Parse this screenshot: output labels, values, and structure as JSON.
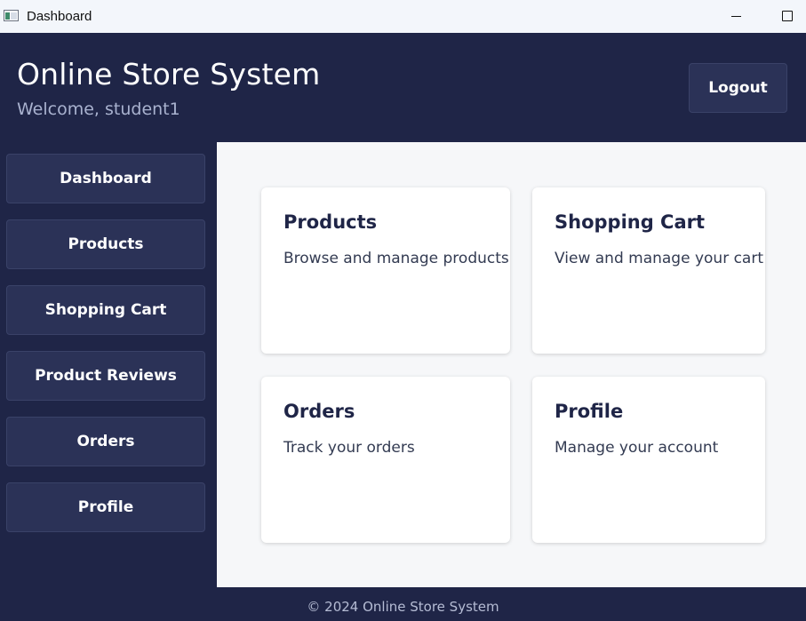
{
  "window": {
    "title": "Dashboard",
    "app_icon": "window-app-icon",
    "controls": [
      "minimize-icon",
      "maximize-icon"
    ]
  },
  "header": {
    "title": "Online Store System",
    "welcome": "Welcome, student1",
    "logout_label": "Logout"
  },
  "sidebar": {
    "items": [
      {
        "label": "Dashboard"
      },
      {
        "label": "Products"
      },
      {
        "label": "Shopping Cart"
      },
      {
        "label": "Product Reviews"
      },
      {
        "label": "Orders"
      },
      {
        "label": "Profile"
      }
    ]
  },
  "main": {
    "cards": [
      {
        "title": "Products",
        "description": "Browse and manage products"
      },
      {
        "title": "Shopping Cart",
        "description": "View and manage your cart"
      },
      {
        "title": "Orders",
        "description": "Track your orders"
      },
      {
        "title": "Profile",
        "description": "Manage your account"
      }
    ]
  },
  "footer": {
    "text": "© 2024 Online Store System"
  },
  "colors": {
    "primary_dark": "#1f2547",
    "button_bg": "#2b3257",
    "content_bg": "#f6f7f9",
    "card_bg": "#ffffff"
  }
}
